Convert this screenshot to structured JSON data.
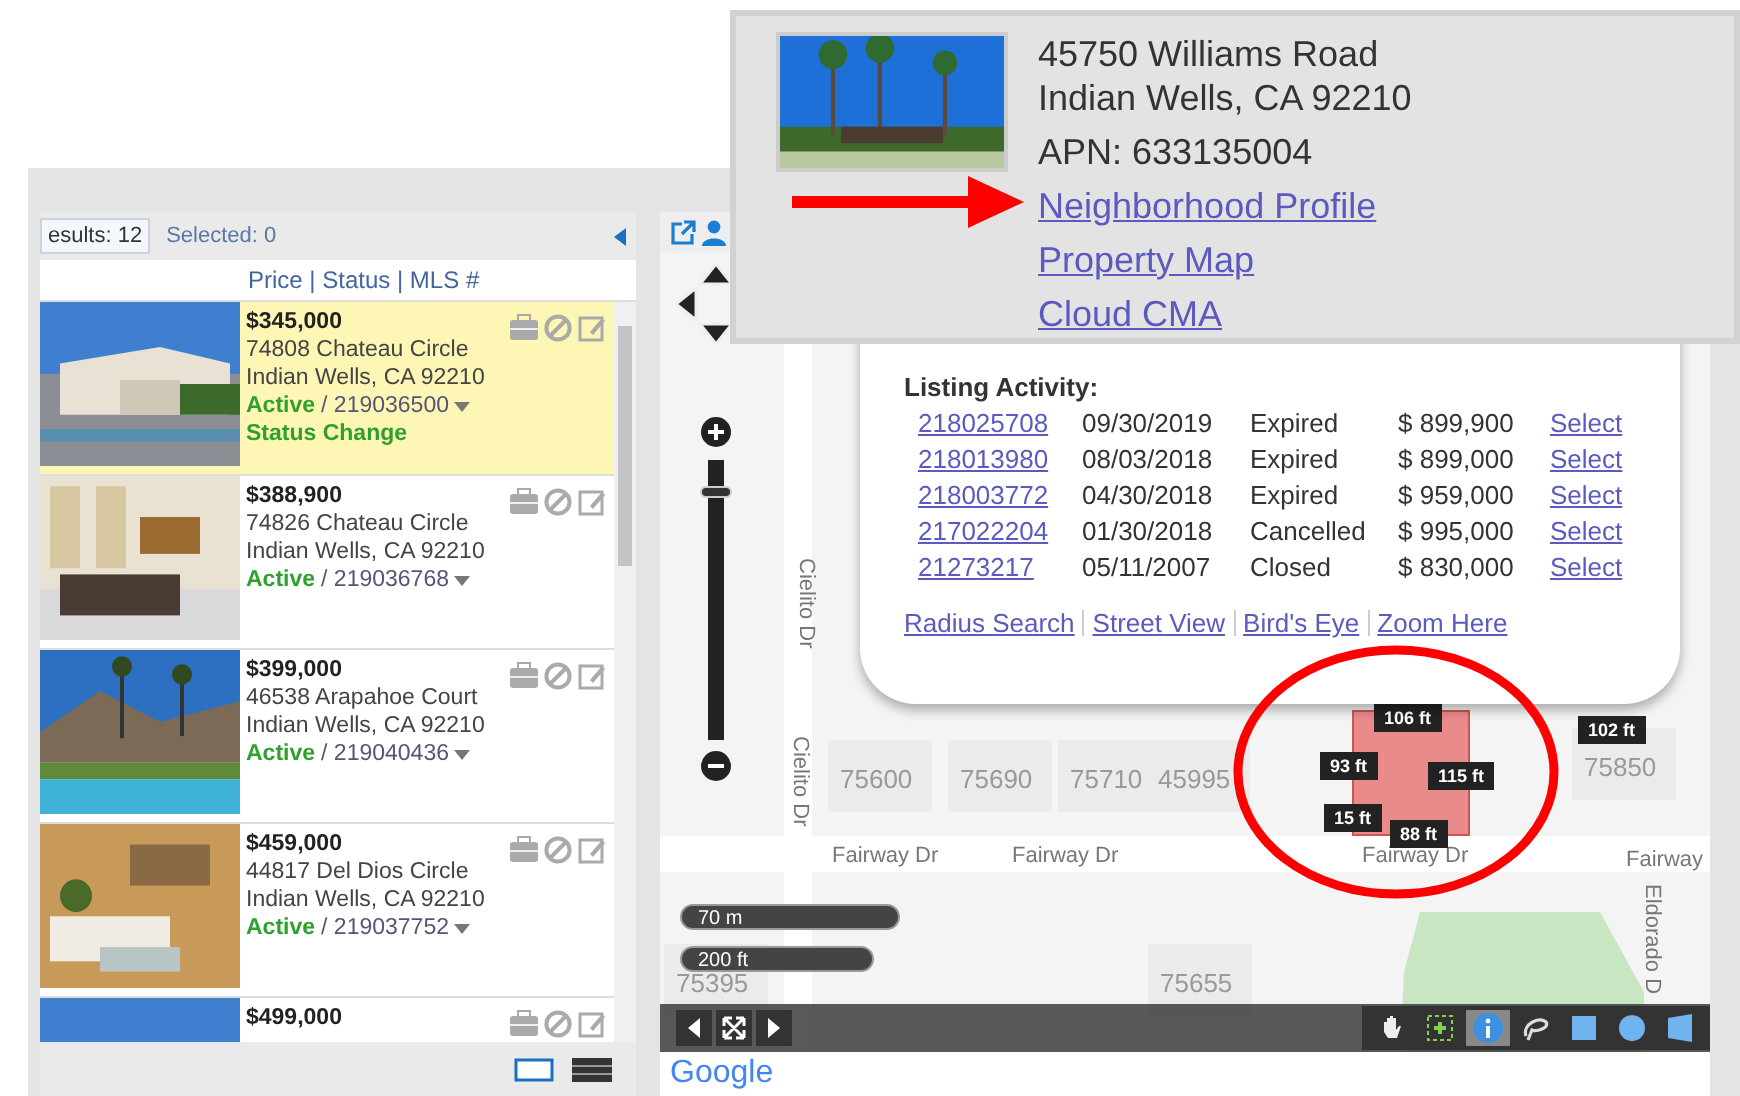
{
  "results_bar": {
    "results": "esults: 12",
    "selected": "Selected: 0"
  },
  "list_header": "Price | Status | MLS #",
  "listings": [
    {
      "price": "$345,000",
      "street": "74808 Chateau Circle",
      "city": "Indian Wells, CA 92210",
      "status": "Active",
      "mls": "/ 219036500",
      "note": "Status Change",
      "highlighted": true
    },
    {
      "price": "$388,900",
      "street": "74826 Chateau Circle",
      "city": "Indian Wells, CA 92210",
      "status": "Active",
      "mls": "/ 219036768",
      "highlighted": false
    },
    {
      "price": "$399,000",
      "street": "46538 Arapahoe Court",
      "city": "Indian Wells, CA 92210",
      "status": "Active",
      "mls": "/ 219040436",
      "highlighted": false
    },
    {
      "price": "$459,000",
      "street": "44817 Del Dios Circle",
      "city": "Indian Wells, CA 92210",
      "status": "Active",
      "mls": "/ 219037752",
      "highlighted": false
    },
    {
      "price": "$499,000",
      "highlighted": false
    }
  ],
  "map": {
    "house_numbers": [
      "75600",
      "75690",
      "75710",
      "45995",
      "75850",
      "75395",
      "75655"
    ],
    "streets": [
      "Fairway Dr",
      "Fairway Dr",
      "Fairway Dr",
      "Fairway"
    ],
    "vertical_streets": [
      "Cielito Dr",
      "Cielito Dr",
      "Eldorado D"
    ],
    "measurements": [
      "106 ft",
      "93 ft",
      "115 ft",
      "15 ft",
      "88 ft",
      "102 ft"
    ],
    "scale": [
      "70 m",
      "200 ft"
    ],
    "zoom": {
      "level": 0.9
    },
    "tools": [
      {
        "kind": "pan",
        "selected": false
      },
      {
        "kind": "select",
        "selected": false
      },
      {
        "kind": "info",
        "selected": true
      },
      {
        "kind": "lasso",
        "selected": false
      },
      {
        "kind": "square",
        "selected": false
      },
      {
        "kind": "circle",
        "selected": false
      },
      {
        "kind": "polygon",
        "selected": false
      }
    ],
    "attribution": "Google"
  },
  "listing_activity": {
    "title": "Listing Activity:",
    "rows": [
      {
        "mls": "218025708",
        "date": "09/30/2019",
        "status": "Expired",
        "price": "$ 899,900",
        "action": "Select"
      },
      {
        "mls": "218013980",
        "date": "08/03/2018",
        "status": "Expired",
        "price": "$ 899,000",
        "action": "Select"
      },
      {
        "mls": "218003772",
        "date": "04/30/2018",
        "status": "Expired",
        "price": "$ 959,000",
        "action": "Select"
      },
      {
        "mls": "217022204",
        "date": "01/30/2018",
        "status": "Cancelled",
        "price": "$ 995,000",
        "action": "Select"
      },
      {
        "mls": "21273217",
        "date": "05/11/2007",
        "status": "Closed",
        "price": "$ 830,000",
        "action": "Select"
      }
    ],
    "links": [
      "Radius Search",
      "Street View",
      "Bird's Eye",
      "Zoom Here"
    ]
  },
  "property_popup": {
    "street": "45750 Williams Road",
    "city": "Indian Wells, CA 92210",
    "apn": "APN: 633135004",
    "links": [
      "Neighborhood Profile",
      "Property Map",
      "Cloud CMA"
    ]
  }
}
